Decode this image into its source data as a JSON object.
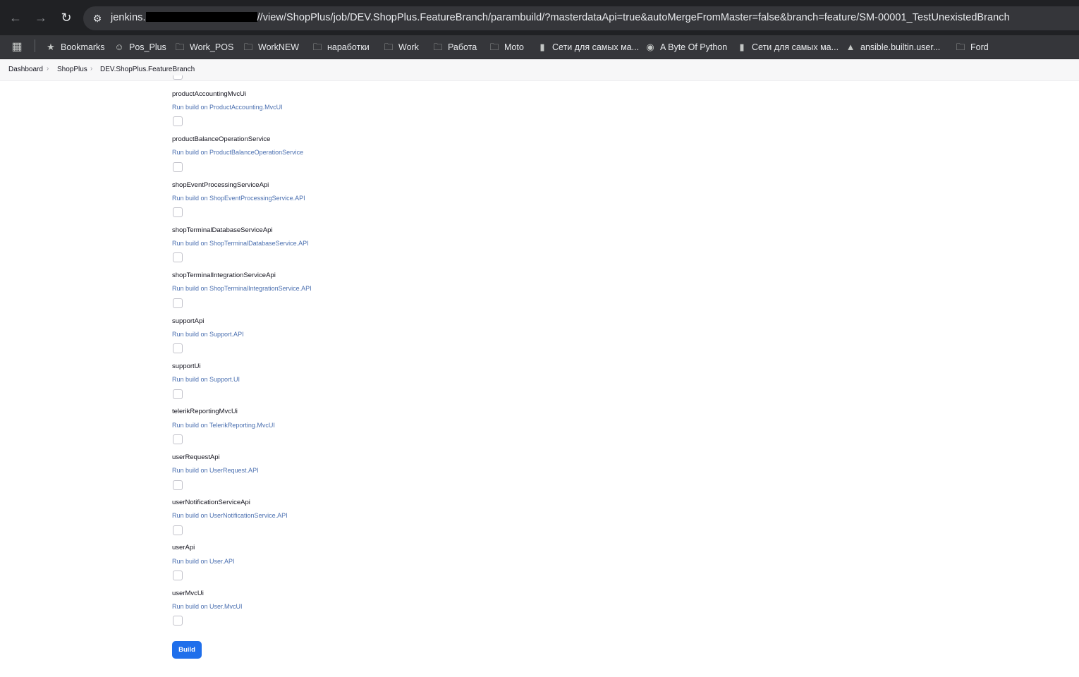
{
  "browser": {
    "url_host": "jenkins.",
    "url_path": "//view/ShopPlus/job/DEV.ShopPlus.FeatureBranch/parambuild/?masterdataApi=true&autoMergeFromMaster=false&branch=feature/SM-00001_TestUnexistedBranch",
    "bookmarks": [
      {
        "label": "Bookmarks",
        "icon": "star-icon"
      },
      {
        "label": "Pos_Plus",
        "icon": "avatar-icon"
      },
      {
        "label": "Work_POS",
        "icon": "folder-icon"
      },
      {
        "label": "WorkNEW",
        "icon": "folder-icon"
      },
      {
        "label": "наработки",
        "icon": "folder-icon"
      },
      {
        "label": "Work",
        "icon": "folder-icon"
      },
      {
        "label": "Работа",
        "icon": "folder-icon"
      },
      {
        "label": "Moto",
        "icon": "folder-icon"
      },
      {
        "label": "Сети для самых ма...",
        "icon": "page-icon"
      },
      {
        "label": "A Byte Of Python",
        "icon": "globe-icon"
      },
      {
        "label": "Сети для самых ма...",
        "icon": "page-icon"
      },
      {
        "label": "ansible.builtin.user...",
        "icon": "ansible-icon"
      },
      {
        "label": "Ford",
        "icon": "folder-icon"
      }
    ]
  },
  "breadcrumb": [
    "Dashboard",
    "ShopPlus",
    "DEV.ShopPlus.FeatureBranch"
  ],
  "parameters": [
    {
      "name": "productAccountingMvcUi",
      "description": "Run build on ProductAccounting.MvcUI"
    },
    {
      "name": "productBalanceOperationService",
      "description": "Run build on ProductBalanceOperationService"
    },
    {
      "name": "shopEventProcessingServiceApi",
      "description": "Run build on ShopEventProcessingService.API"
    },
    {
      "name": "shopTerminalDatabaseServiceApi",
      "description": "Run build on ShopTerminalDatabaseService.API"
    },
    {
      "name": "shopTerminalIntegrationServiceApi",
      "description": "Run build on ShopTerminalIntegrationService.API"
    },
    {
      "name": "supportApi",
      "description": "Run build on Support.API"
    },
    {
      "name": "supportUi",
      "description": "Run build on Support.UI"
    },
    {
      "name": "telerikReportingMvcUi",
      "description": "Run build on TelerikReporting.MvcUI"
    },
    {
      "name": "userRequestApi",
      "description": "Run build on UserRequest.API"
    },
    {
      "name": "userNotificationServiceApi",
      "description": "Run build on UserNotificationService.API"
    },
    {
      "name": "userApi",
      "description": "Run build on User.API"
    },
    {
      "name": "userMvcUi",
      "description": "Run build on User.MvcUI"
    }
  ],
  "build_button": "Build"
}
